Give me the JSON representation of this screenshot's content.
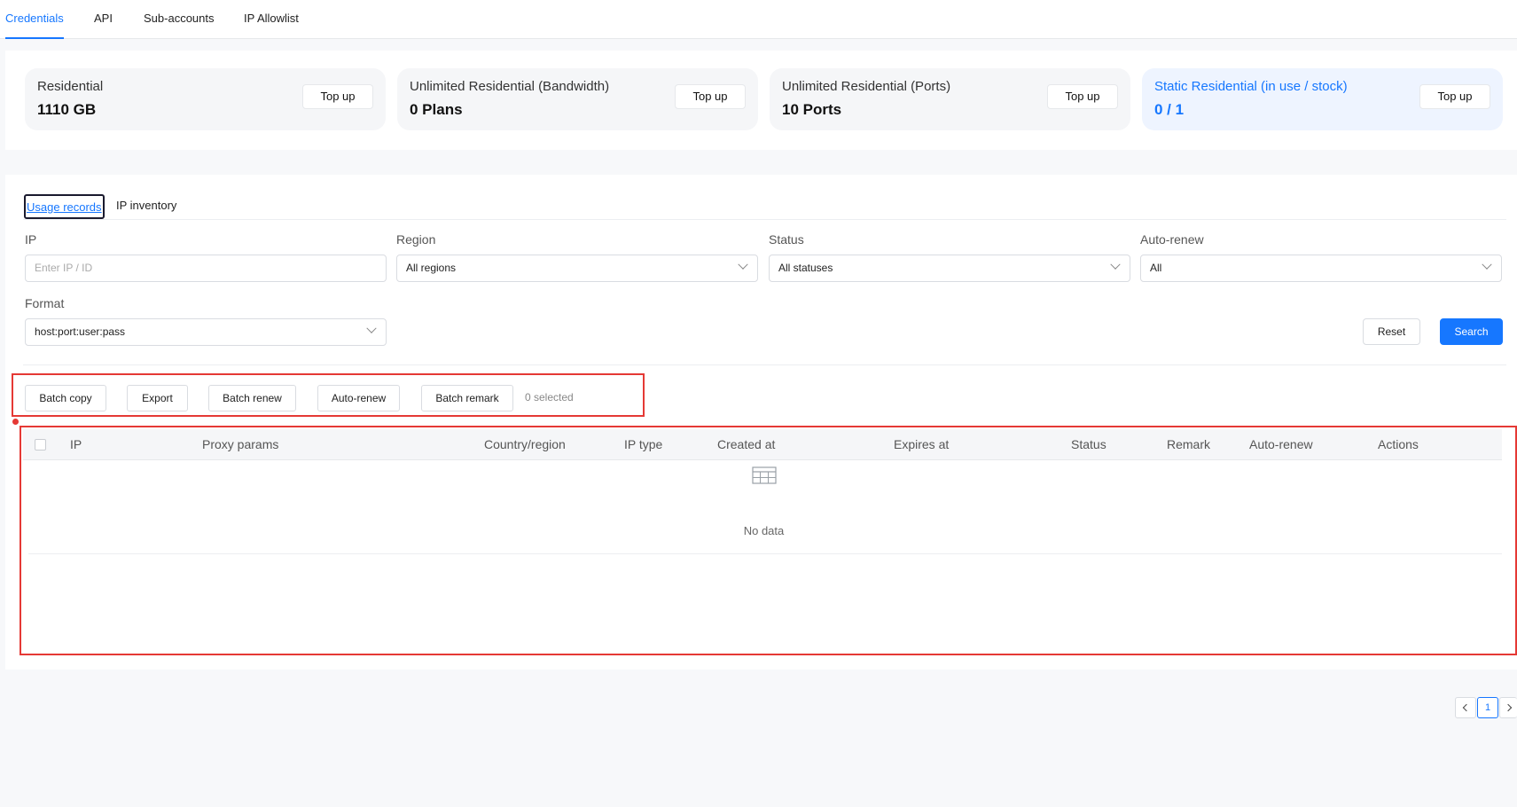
{
  "topnav": {
    "tabs": [
      "Credentials",
      "API",
      "Sub-accounts",
      "IP Allowlist"
    ]
  },
  "summary": {
    "cards": [
      {
        "title": "Residential",
        "value": "1110 GB",
        "button": "Top up"
      },
      {
        "title": "Unlimited Residential (Bandwidth)",
        "value": "0 Plans",
        "button": "Top up"
      },
      {
        "title": "Unlimited Residential (Ports)",
        "value": "10 Ports",
        "button": "Top up"
      },
      {
        "title": "Static Residential (in use / stock)",
        "value": "0 / 1",
        "button": "Top up"
      }
    ]
  },
  "subtabs": [
    "Usage records",
    "IP inventory"
  ],
  "filters": {
    "ip_label": "IP",
    "ip_placeholder": "Enter IP / ID",
    "region_label": "Region",
    "region_value": "All regions",
    "status_label": "Status",
    "status_value": "All statuses",
    "autorenew_label": "Auto-renew",
    "autorenew_value": "All",
    "format_label": "Format",
    "format_value": "host:port:user:pass",
    "reset": "Reset",
    "search": "Search"
  },
  "batch": {
    "buttons": [
      "Batch copy",
      "Export",
      "Batch renew",
      "Auto-renew",
      "Batch remark"
    ],
    "selected_text": "0 selected"
  },
  "table": {
    "columns": [
      "IP",
      "Proxy params",
      "Country/region",
      "IP type",
      "Created at",
      "Expires at",
      "Status",
      "Remark",
      "Auto-renew",
      "Actions"
    ],
    "empty_text": "No data"
  },
  "pagination": {
    "current": "1"
  },
  "colors": {
    "accent": "#1677ff",
    "annotation_red": "#e53935"
  }
}
